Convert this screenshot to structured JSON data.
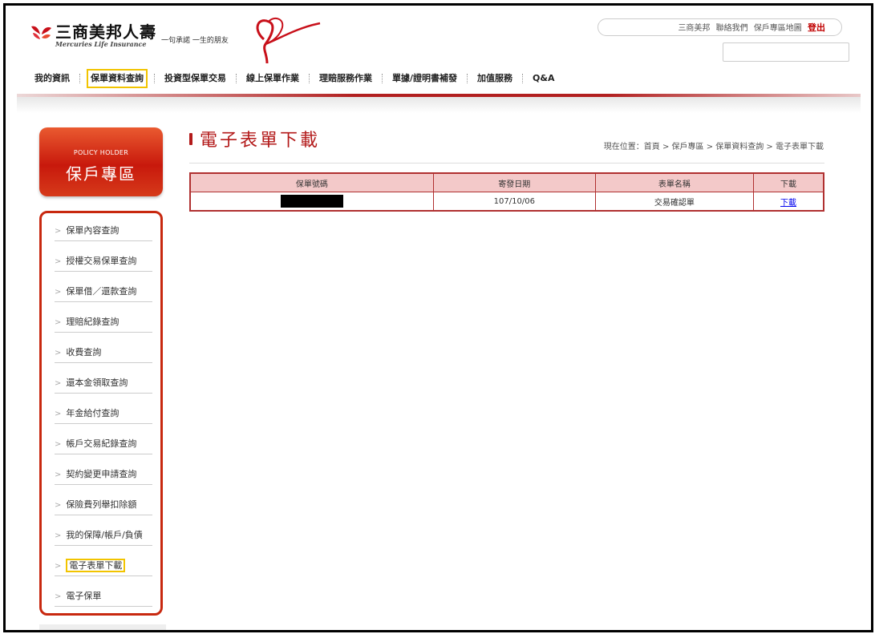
{
  "header": {
    "brand_name": "三商美邦人壽",
    "brand_english": "Mercuries Life Insurance",
    "slogan": "一句承諾 一生的朋友",
    "top_links": [
      "三商美邦",
      "聯絡我們",
      "保戶專區地圖"
    ],
    "logout_label": "登出",
    "search": {
      "value": "",
      "placeholder": ""
    }
  },
  "nav": {
    "items": [
      {
        "label": "我的資訊"
      },
      {
        "label": "保單資料查詢"
      },
      {
        "label": "投資型保單交易"
      },
      {
        "label": "線上保單作業"
      },
      {
        "label": "理賠服務作業"
      },
      {
        "label": "單據/證明書補發"
      },
      {
        "label": "加值服務"
      },
      {
        "label": "Q&A"
      }
    ]
  },
  "sidebar": {
    "badge_en": "POLICY HOLDER",
    "badge_zh": "保戶專區",
    "items": [
      {
        "label": "保單內容查詢"
      },
      {
        "label": "授權交易保單查詢"
      },
      {
        "label": "保單借／還款查詢"
      },
      {
        "label": "理賠紀錄查詢"
      },
      {
        "label": "收費查詢"
      },
      {
        "label": "還本金領取查詢"
      },
      {
        "label": "年金給付查詢"
      },
      {
        "label": "帳戶交易紀錄查詢"
      },
      {
        "label": "契約變更申請查詢"
      },
      {
        "label": "保險費列舉扣除額"
      },
      {
        "label": "我的保障/帳戶/負債"
      },
      {
        "label": "電子表單下載"
      },
      {
        "label": "電子保單"
      }
    ]
  },
  "main": {
    "title": "電子表單下載",
    "breadcrumb": "現在位置：首頁 > 保戶專區 > 保單資料查詢 > 電子表單下載",
    "table": {
      "headers": [
        "保單號碼",
        "寄發日期",
        "表單名稱",
        "下載"
      ],
      "rows": [
        {
          "policy_no": "",
          "date": "107/10/06",
          "form_name": "交易確認單",
          "download": "下載"
        }
      ]
    }
  },
  "colors": {
    "brand_red": "#b31a1a",
    "highlight": "#f2c400",
    "table_header": "#f3c9c9"
  }
}
